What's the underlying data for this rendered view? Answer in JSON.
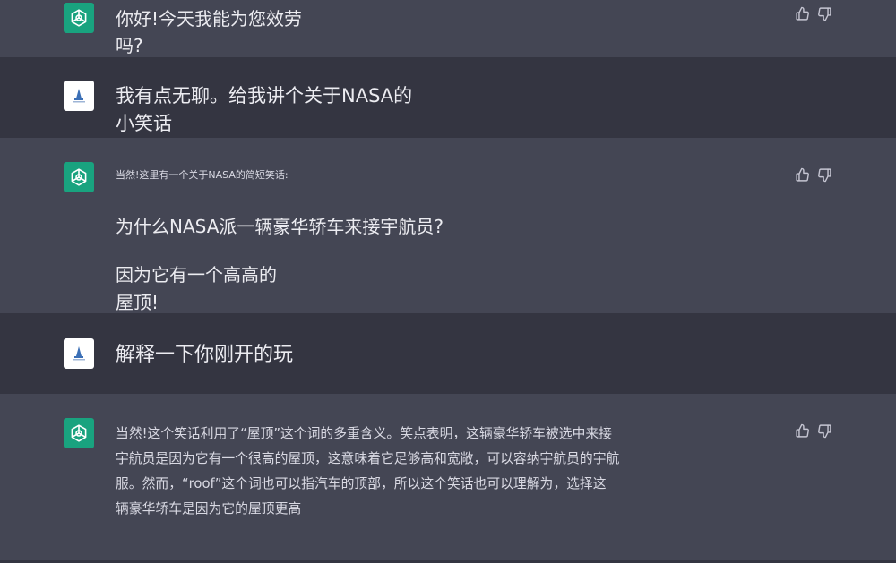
{
  "messages": [
    {
      "role": "assistant",
      "text": "你好!今天我能为您效劳\n吗?"
    },
    {
      "role": "user",
      "text": "我有点无聊。给我讲个关于NASA的\n小笑话"
    },
    {
      "role": "assistant",
      "intro": "当然!这里有一个关于NASA的简短笑话:",
      "line1": "为什么NASA派一辆豪华轿车来接宇航员?",
      "line2": "因为它有一个高高的\n屋顶!"
    },
    {
      "role": "user",
      "text": "解释一下你刚开的玩"
    },
    {
      "role": "assistant",
      "text": "当然!这个笑话利用了“屋顶”这个词的多重含义。笑点表明，这辆豪华轿车被选中来接\n宇航员是因为它有一个很高的屋顶，这意味着它足够高和宽敞，可以容纳宇航员的宇航\n服。然而，“roof”这个词也可以指汽车的顶部，所以这个笑话也可以理解为，选择这\n辆豪华轿车是因为它的屋顶更高"
    }
  ],
  "colors": {
    "assistant_bg": "#444654",
    "user_bg": "#343541",
    "bot_avatar": "#19a37f",
    "text": "#ececf1"
  },
  "icons": [
    "openai-logo-icon",
    "user-avatar-icon",
    "thumbs-up-icon",
    "thumbs-down-icon"
  ]
}
